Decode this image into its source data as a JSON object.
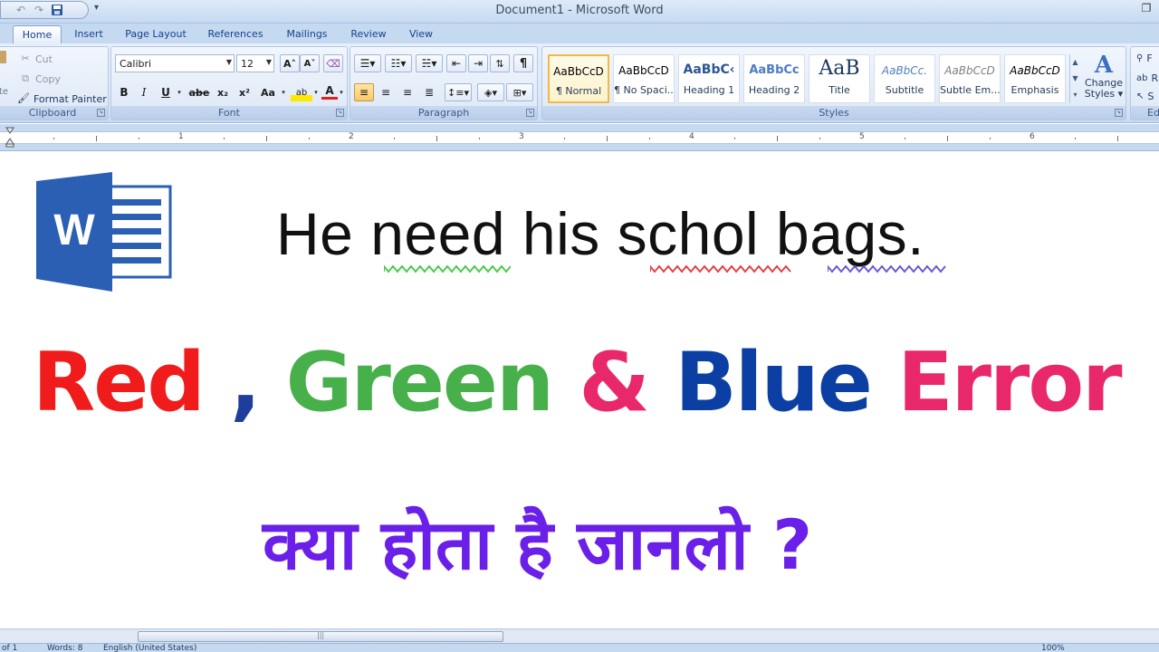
{
  "window": {
    "title": "Document1 - Microsoft Word"
  },
  "quick_access": {
    "icons": [
      "undo-icon",
      "redo-icon",
      "save-icon"
    ]
  },
  "tabs": [
    "Home",
    "Insert",
    "Page Layout",
    "References",
    "Mailings",
    "Review",
    "View"
  ],
  "active_tab": "Home",
  "ribbon": {
    "clipboard": {
      "label": "Clipboard",
      "paste_partial": "te",
      "cut": "Cut",
      "copy": "Copy",
      "format_painter": "Format Painter"
    },
    "font": {
      "label": "Font",
      "font_name": "Calibri",
      "font_size": "12",
      "grow_glyph": "A˄",
      "shrink_glyph": "A˅",
      "bold": "B",
      "italic": "I",
      "underline": "U",
      "strike": "abe",
      "subscript": "x₂",
      "superscript": "x²",
      "case": "Aa",
      "highlight": "ab",
      "font_color": "A"
    },
    "paragraph": {
      "label": "Paragraph",
      "show_marks": "¶"
    },
    "styles": {
      "label": "Styles",
      "items": [
        {
          "sample": "AaBbCcD",
          "name": "¶ Normal"
        },
        {
          "sample": "AaBbCcD",
          "name": "¶ No Spaci..."
        },
        {
          "sample": "AaBbC‹",
          "name": "Heading 1"
        },
        {
          "sample": "AaBbCc",
          "name": "Heading 2"
        },
        {
          "sample": "AaB",
          "name": "Title"
        },
        {
          "sample": "AaBbCc.",
          "name": "Subtitle"
        },
        {
          "sample": "AaBbCcD",
          "name": "Subtle Em..."
        },
        {
          "sample": "AaBbCcD",
          "name": "Emphasis"
        }
      ],
      "change_styles_line1": "Change",
      "change_styles_line2": "Styles ▾"
    },
    "editing": {
      "label": "Ed",
      "items": [
        "F",
        "R",
        "S"
      ]
    }
  },
  "ruler": {
    "numbers": [
      "1",
      "2",
      "3",
      "4",
      "5",
      "6"
    ]
  },
  "document": {
    "sentence_words": [
      "He",
      "need",
      "his",
      "schol",
      "bags."
    ],
    "headline": {
      "red": "Red",
      "comma": " , ",
      "green": "Green",
      "amp": " & ",
      "blue": "Blue",
      "error": " Error"
    },
    "hindi_text": "क्या होता है जानलो ?",
    "colors": {
      "red": "#f01c1c",
      "comma": "#1f3e9b",
      "green": "#47b04b",
      "amp": "#e8286a",
      "blue": "#0b3fa3",
      "error": "#e8286a",
      "hindi": "#6a20e8",
      "squiggle_green": "#4cc94c",
      "squiggle_red": "#e04444",
      "squiggle_blue": "#6a5ad8"
    }
  },
  "statusbar": {
    "items": [
      "of 1",
      "Words: 8",
      "English (United States)",
      "100%"
    ]
  }
}
